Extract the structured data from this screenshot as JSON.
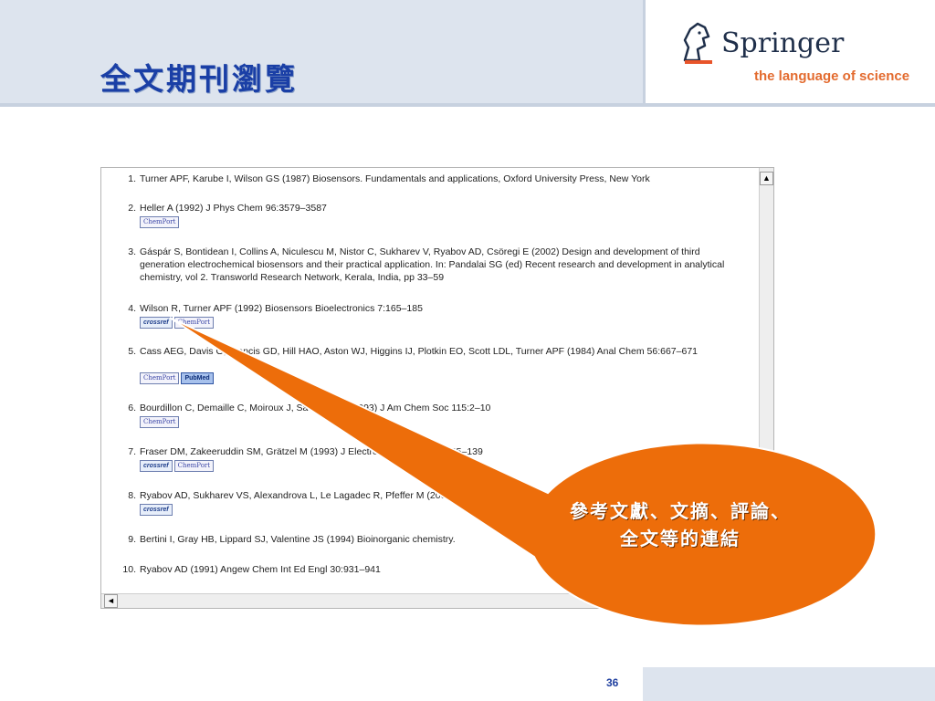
{
  "slide": {
    "title": "全文期刊瀏覽",
    "page_number": "36"
  },
  "logo": {
    "name": "Springer",
    "tagline": "the language of science",
    "icon": "horse-head-icon",
    "accent_color": "#e36b2f"
  },
  "callout": {
    "text": "參考文獻、文摘、評論、全文等的連結",
    "fill_color": "#ed6d0a"
  },
  "references": [
    {
      "num": "1.",
      "text": "Turner APF, Karube I, Wilson GS (1987) Biosensors. Fundamentals and applications, Oxford University Press, New York",
      "badges": []
    },
    {
      "num": "2.",
      "text": "Heller A (1992) J Phys Chem 96:3579–3587",
      "badges": [
        "ChemPort"
      ]
    },
    {
      "num": "3.",
      "text": "Gáspár S, Bontidean I, Collins A, Niculescu M, Nistor C, Sukharev V, Ryabov AD, Csöregi E (2002) Design and development of third generation electrochemical biosensors and their practical application. In: Pandalai SG (ed) Recent research and development in analytical chemistry, vol 2. Transworld Research Network, Kerala, India, pp 33–59",
      "badges": []
    },
    {
      "num": "4.",
      "text": "Wilson R, Turner APF (1992) Biosensors Bioelectronics 7:165–185",
      "badges": [
        "crossref",
        "ChemPort"
      ]
    },
    {
      "num": "5.",
      "text": "Cass AEG, Davis G, Francis GD, Hill HAO, Aston WJ, Higgins IJ, Plotkin EO, Scott LDL, Turner APF (1984) Anal Chem 56:667–671",
      "badges": [
        "ChemPort",
        "PubMed"
      ]
    },
    {
      "num": "6.",
      "text": "Bourdillon C, Demaille C, Moiroux J, Savéant JM (1993) J Am Chem Soc 115:2–10",
      "badges": [
        "ChemPort"
      ]
    },
    {
      "num": "7.",
      "text": "Fraser DM, Zakeeruddin SM, Grätzel M (1993) J Electroanal Chem 359:125–139",
      "badges": [
        "crossref",
        "ChemPort"
      ]
    },
    {
      "num": "8.",
      "text": "Ryabov AD, Sukharev VS, Alexandrova L, Le Lagadec R, Pfeffer M (2001) Inorg Chem",
      "badges": [
        "crossref"
      ]
    },
    {
      "num": "9.",
      "text": "Bertini I, Gray HB, Lippard SJ, Valentine JS (1994) Bioinorganic chemistry.",
      "badges": []
    },
    {
      "num": "10.",
      "text": "Ryabov AD (1991) Angew Chem Int Ed Engl 30:931–941",
      "badges": []
    }
  ],
  "scrollbars": {
    "up_arrow": "▲",
    "left_arrow": "◄"
  }
}
